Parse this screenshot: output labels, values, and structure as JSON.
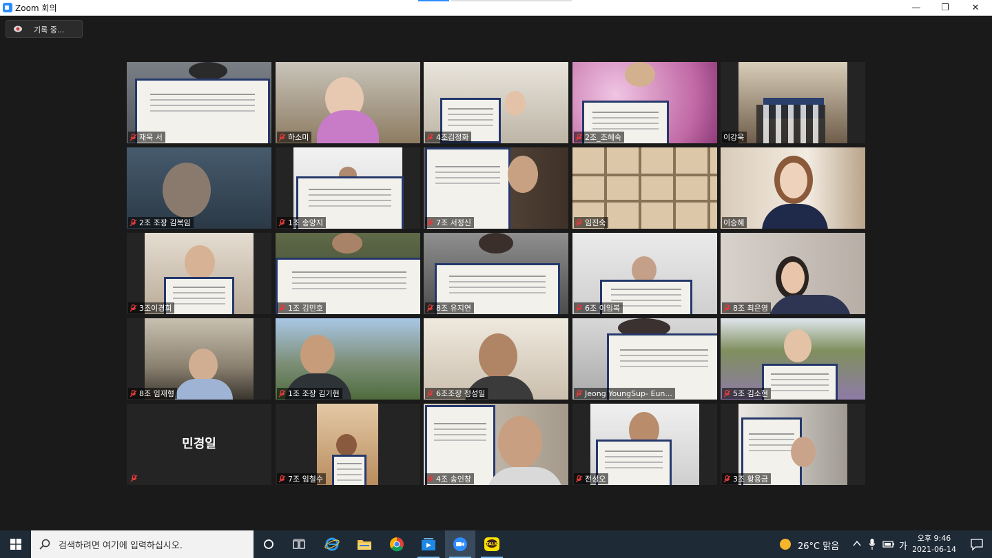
{
  "window": {
    "title": "Zoom 회의",
    "minimize": "—",
    "maximize": "❐",
    "close": "✕"
  },
  "recording": {
    "label": "기록 중..."
  },
  "participants": [
    {
      "name": "재욱 서"
    },
    {
      "name": "하소미"
    },
    {
      "name": "4조김정화"
    },
    {
      "name": "2조_조혜숙"
    },
    {
      "name": "이강욱"
    },
    {
      "name": "2조 조장 김복임"
    },
    {
      "name": "1조 송양지"
    },
    {
      "name": "7조 서정신"
    },
    {
      "name": "임진숙"
    },
    {
      "name": "이승혜"
    },
    {
      "name": "3조이경희"
    },
    {
      "name": "1조 김민호"
    },
    {
      "name": "8조 유지연"
    },
    {
      "name": "6조 이임복"
    },
    {
      "name": "8조 최은영"
    },
    {
      "name": "8조 임재형"
    },
    {
      "name": "1조 조장 김기현"
    },
    {
      "name": "6조조장 정성일"
    },
    {
      "name": "Jeong YoungSup- Eun..."
    },
    {
      "name": "5조 김소현"
    },
    {
      "name": "민경일"
    },
    {
      "name": "7조 임철수"
    },
    {
      "name": "4조 송인창"
    },
    {
      "name": "전성오"
    },
    {
      "name": "3조 황용금"
    }
  ],
  "taskbar": {
    "search_placeholder": "검색하려면 여기에 입력하십시오.",
    "weather": "26°C 맑음",
    "ime": "가",
    "time": "오후 9:46",
    "date": "2021-06-14"
  },
  "colors": {
    "accent": "#2d8cff",
    "active_speaker": "#c8e04a",
    "muted": "#e03a3a",
    "taskbar": "#1f2a37"
  }
}
